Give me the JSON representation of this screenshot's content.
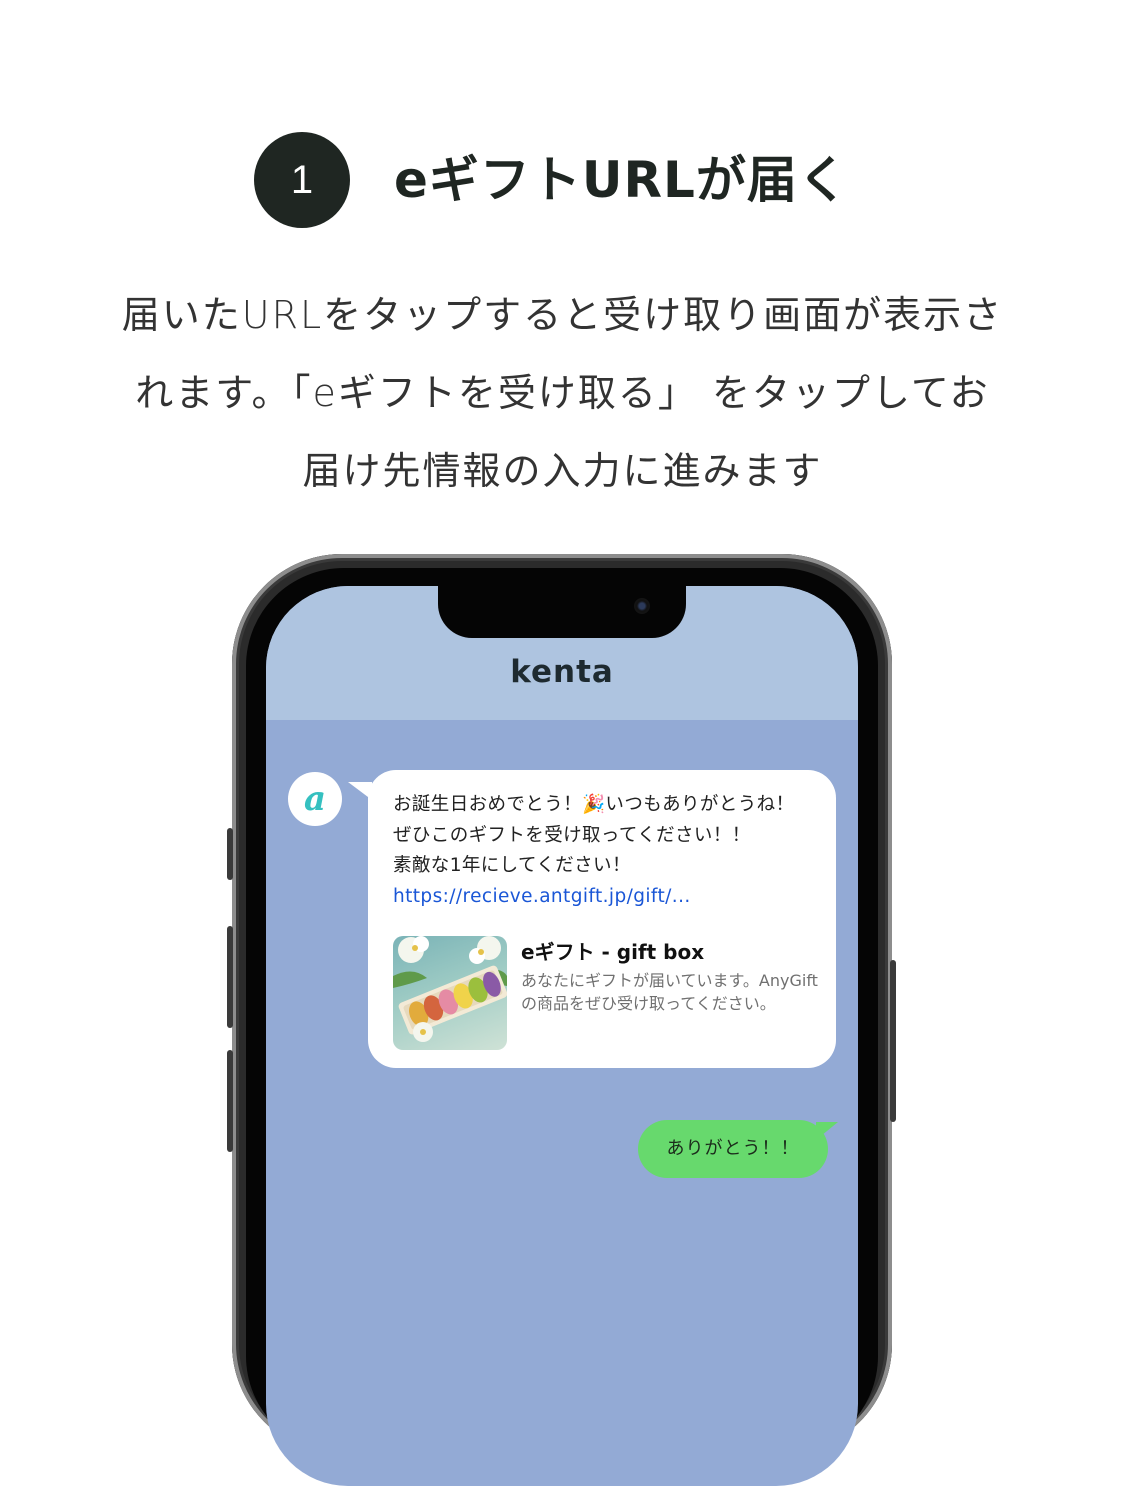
{
  "step": {
    "number": "1",
    "title": "eギフトURLが届く"
  },
  "description": {
    "lines": [
      "届いたURLをタップすると受け取り画面が表示さ",
      "れます。「eギフトを受け取る」 をタップしてお",
      "届け先情報の入力に進みます"
    ]
  },
  "chat": {
    "header_title": "kenta",
    "avatar_icon": "antgift-logo-icon",
    "incoming": {
      "lines": [
        "お誕生日おめでとう！🎉いつもありがとうね！",
        "ぜひこのギフトを受け取ってください！！",
        "素敵な1年にしてください！"
      ],
      "link": "https://recieve.antgift.jp/gift/...",
      "card": {
        "title": "eギフト -  gift box",
        "description": "あなたにギフトが届いています。AnyGiftの商品をぜひ受け取ってください。",
        "thumbnail_icon": "macaron-box-image"
      }
    },
    "outgoing": {
      "text": "ありがとう！！"
    }
  },
  "colors": {
    "badge": "#1f2622",
    "chat_background": "#93aad5",
    "chat_header": "#aec4e0",
    "outgoing_bubble": "#67d96d",
    "link": "#1a56d6"
  }
}
